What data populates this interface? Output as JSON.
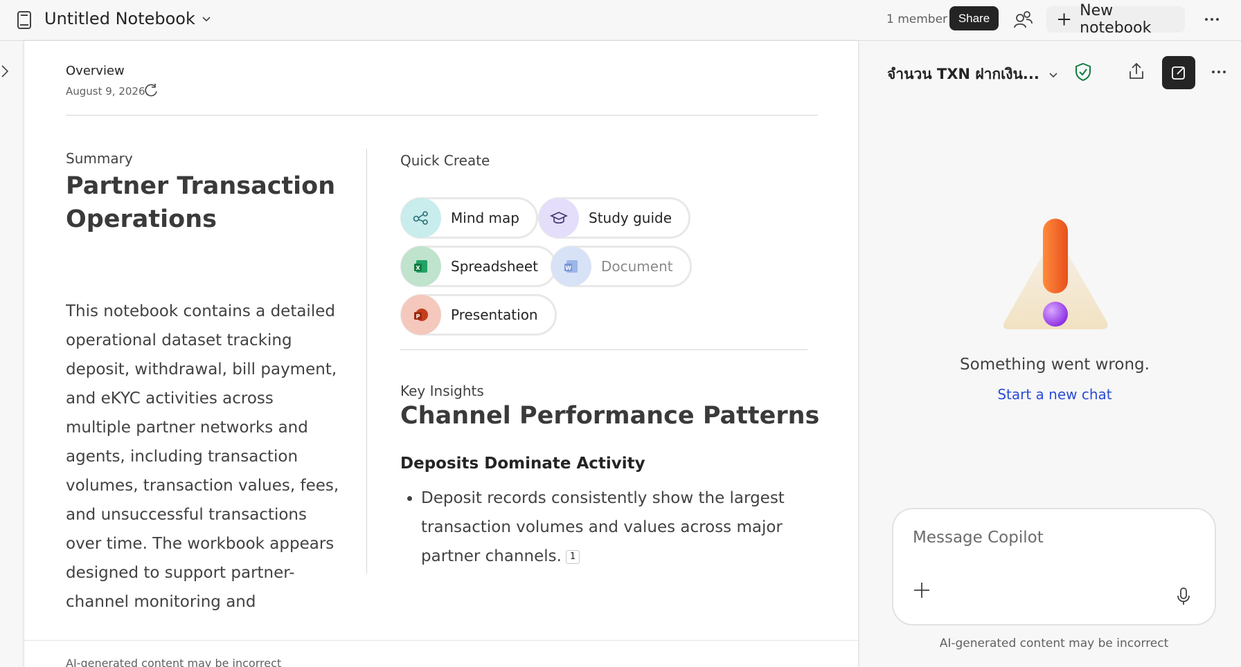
{
  "header": {
    "notebook_title": "Untitled Notebook",
    "member_count": "1 member",
    "share_label": "Share",
    "new_notebook_label": "New notebook"
  },
  "overview": {
    "label": "Overview",
    "date": "August 9, 2026"
  },
  "summary": {
    "label": "Summary",
    "title": "Partner Transaction Operations",
    "body": "This notebook contains a detailed operational dataset tracking deposit, withdrawal, bill payment, and eKYC activities across multiple partner networks and agents, including transaction volumes, transaction values, fees, and unsuccessful transactions over time. The workbook appears designed to support partner-channel monitoring and"
  },
  "quick_create": {
    "label": "Quick Create",
    "items": [
      {
        "label": "Mind map",
        "icon": "mind-map-icon",
        "color": "#c9ecec"
      },
      {
        "label": "Study guide",
        "icon": "graduation-cap-icon",
        "color": "#e5defa"
      },
      {
        "label": "Spreadsheet",
        "icon": "excel-icon",
        "color": "#bfe3cc"
      },
      {
        "label": "Document",
        "icon": "word-icon",
        "color": "#d8e2f7"
      },
      {
        "label": "Presentation",
        "icon": "powerpoint-icon",
        "color": "#f5c8bd"
      }
    ]
  },
  "key_insights": {
    "label": "Key Insights",
    "title": "Channel Performance Patterns",
    "subheading": "Deposits Dominate Activity",
    "bullet": "Deposit records consistently show the largest transaction volumes and values across major partner channels.",
    "citation": "1"
  },
  "doc_footer": "AI-generated content may be incorrect",
  "copilot": {
    "chat_title": "จำนวน TXN ฝากเงิน...",
    "error_text": "Something went wrong.",
    "new_chat_link": "Start a new chat",
    "message_placeholder": "Message Copilot",
    "footer": "AI-generated content may be incorrect"
  }
}
